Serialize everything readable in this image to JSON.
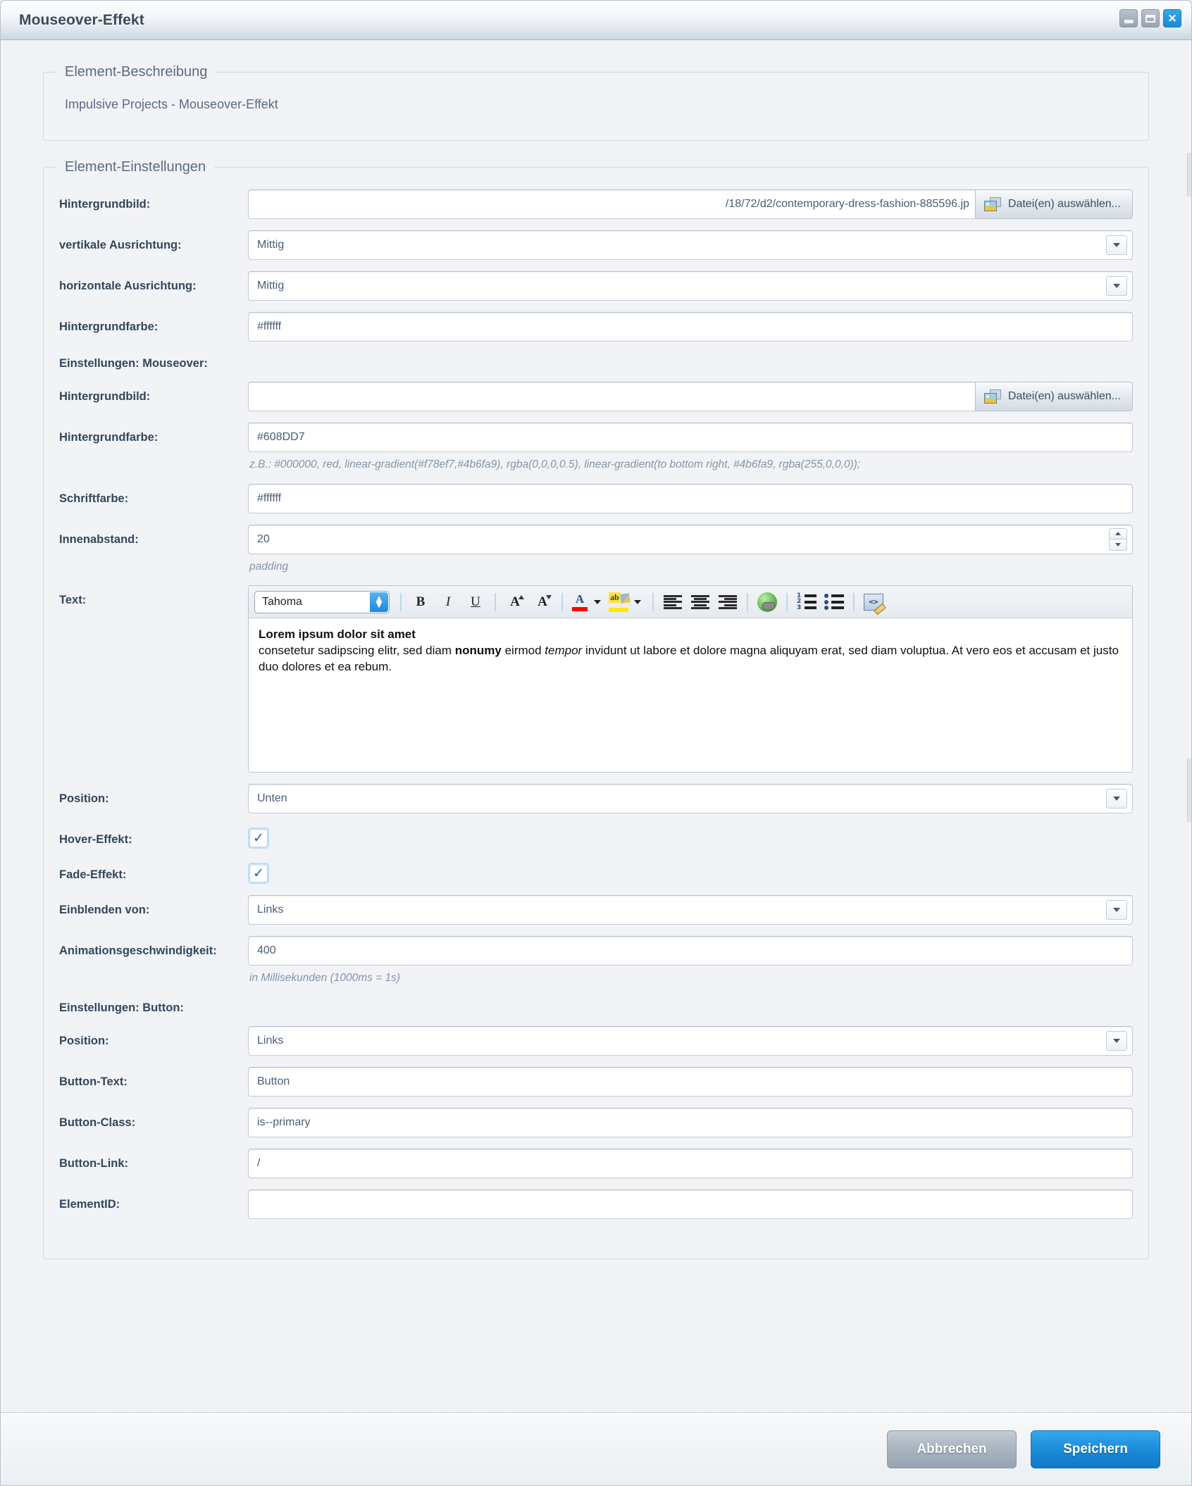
{
  "window": {
    "title": "Mouseover-Effekt",
    "buttons": {
      "minimize": "minimize",
      "maximize": "maximize",
      "close": "×"
    }
  },
  "description_panel": {
    "legend": "Element-Beschreibung",
    "text": "Impulsive Projects - Mouseover-Effekt"
  },
  "settings_panel": {
    "legend": "Element-Einstellungen",
    "fields": {
      "background_image_label": "Hintergrundbild:",
      "background_image_value": "/18/72/d2/contemporary-dress-fashion-885596.jp",
      "file_button_label": "Datei(en) auswählen...",
      "vertical_align_label": "vertikale Ausrichtung:",
      "vertical_align_value": "Mittig",
      "horizontal_align_label": "horizontale Ausrichtung:",
      "horizontal_align_value": "Mittig",
      "background_color_label": "Hintergrundfarbe:",
      "background_color_value": "#ffffff"
    },
    "mouseover_section": {
      "heading": "Einstellungen: Mouseover:",
      "background_image_label": "Hintergrundbild:",
      "background_image_value": "",
      "file_button_label": "Datei(en) auswählen...",
      "background_color_label": "Hintergrundfarbe:",
      "background_color_value": "#608DD7",
      "background_color_hint": "z.B.: #000000, red, linear-gradient(#f78ef7,#4b6fa9), rgba(0,0,0,0.5), linear-gradient(to bottom right, #4b6fa9, rgba(255,0,0,0));",
      "font_color_label": "Schriftfarbe:",
      "font_color_value": "#ffffff",
      "padding_label": "Innenabstand:",
      "padding_value": "20",
      "padding_hint": "padding",
      "text_label": "Text:",
      "position_label": "Position:",
      "position_value": "Unten",
      "hover_effect_label": "Hover-Effekt:",
      "hover_effect_checked": "✓",
      "fade_effect_label": "Fade-Effekt:",
      "fade_effect_checked": "✓",
      "fade_from_label": "Einblenden von:",
      "fade_from_value": "Links",
      "animation_speed_label": "Animationsgeschwindigkeit:",
      "animation_speed_value": "400",
      "animation_speed_hint": "in Millisekunden (1000ms = 1s)"
    },
    "editor": {
      "font_family": "Tahoma",
      "toolbar": {
        "bold": "B",
        "italic": "I",
        "underline": "U",
        "grow_font": "A",
        "shrink_font": "A",
        "text_color": "A",
        "text_color_swatch": "#ff0000",
        "highlight": "ab",
        "highlight_swatch": "#ffe900"
      },
      "content_title": "Lorem ipsum dolor sit amet",
      "content_line1_a": "consetetur sadipscing elitr, sed diam ",
      "content_line1_bold": "nonumy",
      "content_line1_b": " eirmod ",
      "content_line1_italic": "tempor",
      "content_line1_c": " invidunt ut labore et dolore magna",
      "content_line2": "aliquyam erat, sed diam voluptua. At vero eos et accusam et justo duo dolores et ea rebum."
    },
    "button_section": {
      "heading": "Einstellungen: Button:",
      "position_label": "Position:",
      "position_value": "Links",
      "button_text_label": "Button-Text:",
      "button_text_value": "Button",
      "button_class_label": "Button-Class:",
      "button_class_value": "is--primary",
      "button_link_label": "Button-Link:",
      "button_link_value": "/",
      "element_id_label": "ElementID:",
      "element_id_value": ""
    }
  },
  "footer": {
    "cancel_label": "Abbrechen",
    "save_label": "Speichern"
  },
  "colors": {
    "accent": "#1b8ad8",
    "label_text": "#34465c",
    "hint_text": "#8795a6",
    "panel_bg": "#f1f3f6"
  }
}
